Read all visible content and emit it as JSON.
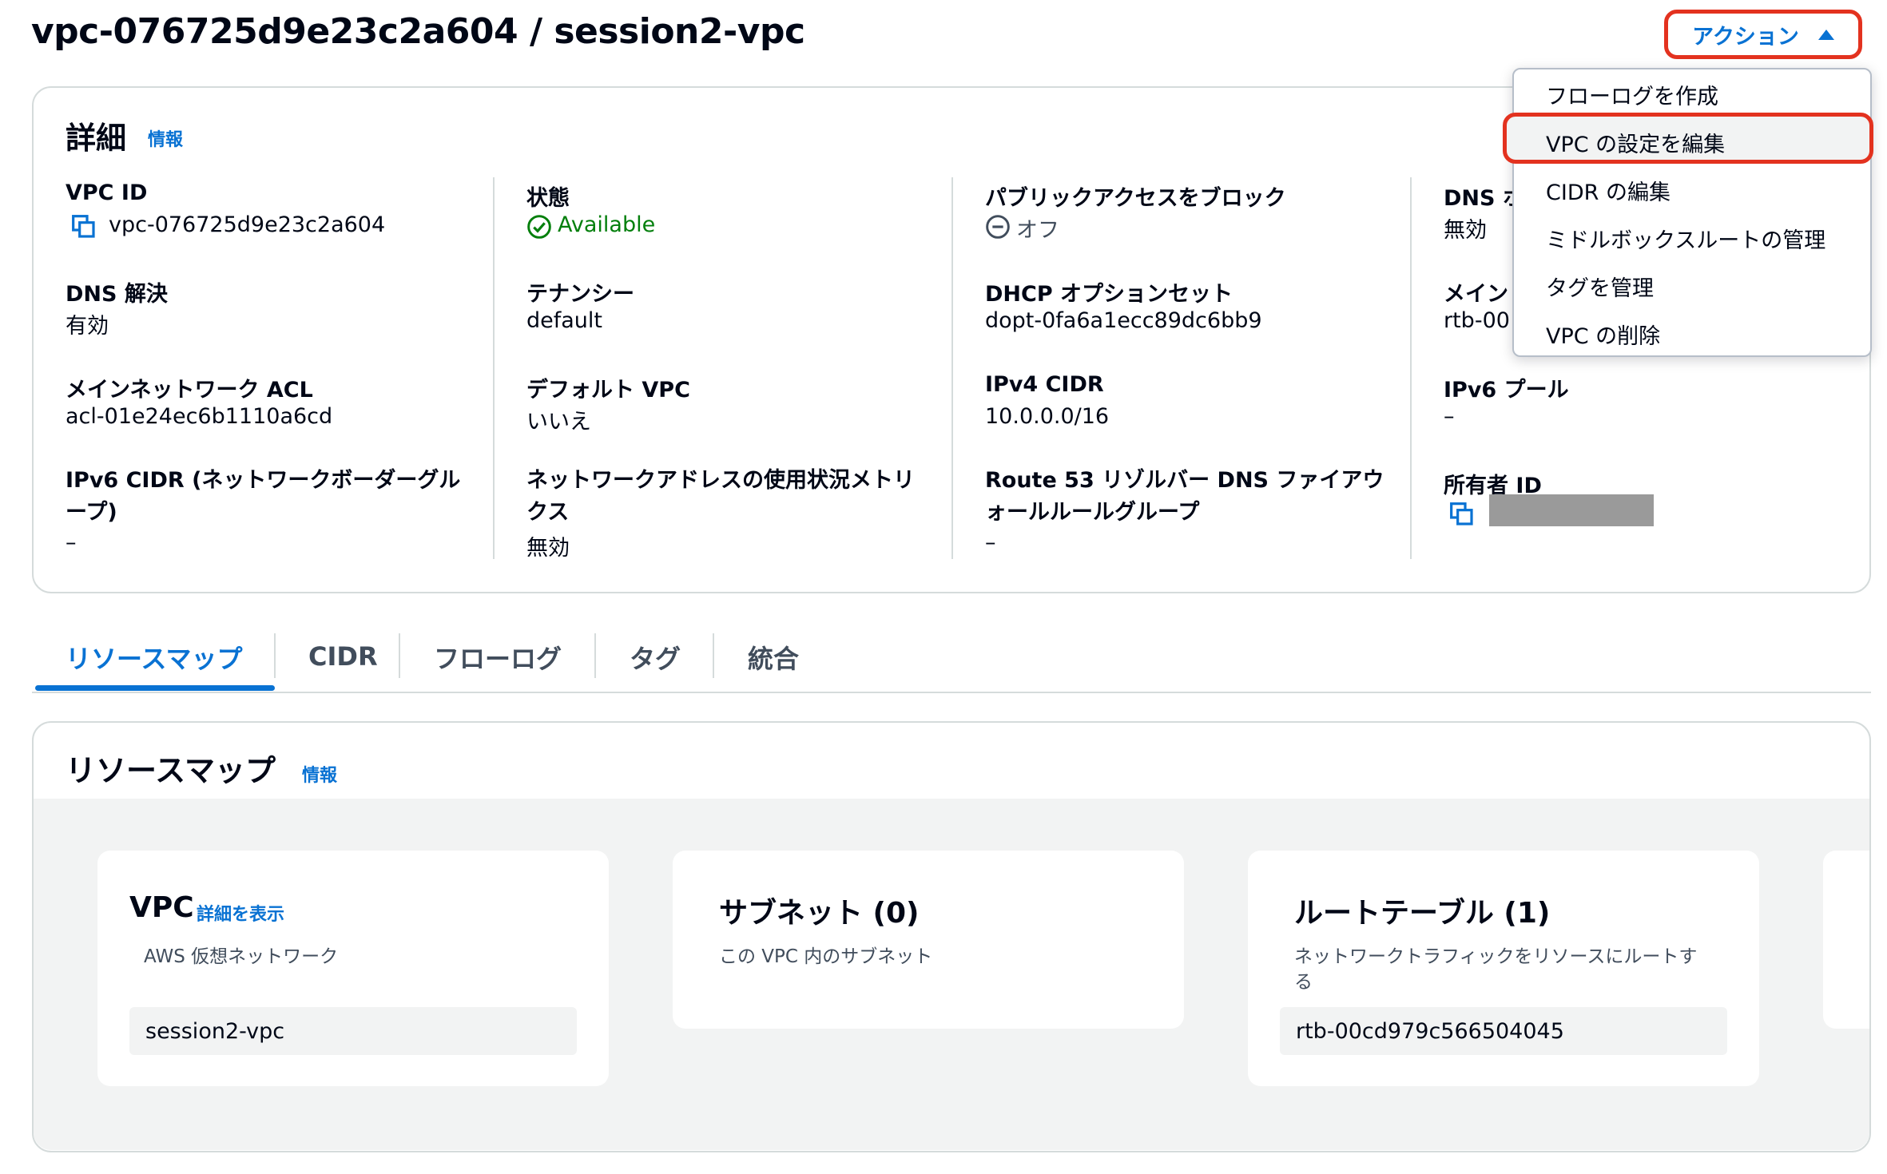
{
  "header": {
    "title": "vpc-076725d9e23c2a604 / session2-vpc"
  },
  "actions": {
    "label": "アクション",
    "menu": [
      "フローログを作成",
      "VPC の設定を編集",
      "CIDR の編集",
      "ミドルボックスルートの管理",
      "タグを管理",
      "VPC の削除"
    ],
    "highlighted": "VPC の設定を編集"
  },
  "details": {
    "title": "詳細",
    "info": "情報",
    "columns": [
      [
        {
          "label": "VPC ID",
          "value": "vpc-076725d9e23c2a604"
        },
        {
          "label": "DNS 解決",
          "value": "有効"
        },
        {
          "label": "メインネットワーク ACL",
          "value": "acl-01e24ec6b1110a6cd"
        },
        {
          "label": "IPv6 CIDR (ネットワークボーダーグループ)",
          "value": "–"
        }
      ],
      [
        {
          "label": "状態",
          "value": "Available"
        },
        {
          "label": "テナンシー",
          "value": "default"
        },
        {
          "label": "デフォルト VPC",
          "value": "いいえ"
        },
        {
          "label": "ネットワークアドレスの使用状況メトリクス",
          "value": "無効"
        }
      ],
      [
        {
          "label": "パブリックアクセスをブロック",
          "value": "オフ"
        },
        {
          "label": "DHCP オプションセット",
          "value": "dopt-0fa6a1ecc89dc6bb9"
        },
        {
          "label": "IPv4 CIDR",
          "value": "10.0.0.0/16"
        },
        {
          "label": "Route 53 リゾルバー DNS ファイアウォールルールグループ",
          "value": "–"
        }
      ],
      [
        {
          "label": "DNS ホ",
          "value": "無効"
        },
        {
          "label": "メイン",
          "value": "rtb-00"
        },
        {
          "label": "IPv6 プール",
          "value": "–"
        },
        {
          "label": "所有者 ID",
          "value": ""
        }
      ]
    ]
  },
  "tabs": [
    "リソースマップ",
    "CIDR",
    "フローログ",
    "タグ",
    "統合"
  ],
  "active_tab": "リソースマップ",
  "resource_map": {
    "title": "リソースマップ",
    "info": "情報",
    "cards": [
      {
        "title": "VPC",
        "link": "詳細を表示",
        "desc": "AWS 仮想ネットワーク",
        "chip": "session2-vpc"
      },
      {
        "title": "サブネット (0)",
        "desc": "この VPC 内のサブネット"
      },
      {
        "title": "ルートテーブル (1)",
        "desc": "ネットワークトラフィックをリソースにルートする",
        "chip": "rtb-00cd979c566504045"
      }
    ]
  },
  "colors": {
    "accent": "#0972d3",
    "success": "#037f0c",
    "highlight_border": "#e3321f"
  }
}
